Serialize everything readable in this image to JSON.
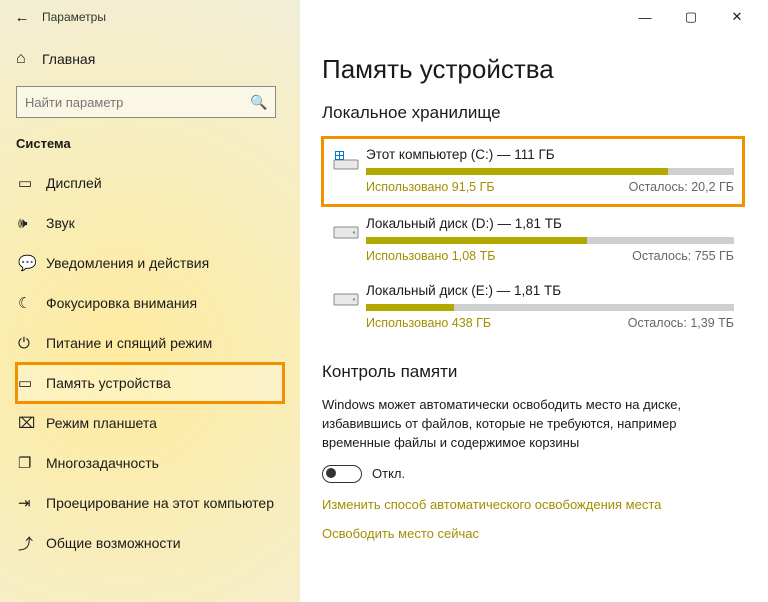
{
  "titlebar": {
    "title": "Параметры"
  },
  "sidebar": {
    "home": "Главная",
    "search_placeholder": "Найти параметр",
    "category": "Система",
    "items": [
      {
        "icon": "display",
        "label": "Дисплей"
      },
      {
        "icon": "sound",
        "label": "Звук"
      },
      {
        "icon": "notify",
        "label": "Уведомления и действия"
      },
      {
        "icon": "focus",
        "label": "Фокусировка внимания"
      },
      {
        "icon": "power",
        "label": "Питание и спящий режим"
      },
      {
        "icon": "storage",
        "label": "Память устройства",
        "selected": true
      },
      {
        "icon": "tablet",
        "label": "Режим планшета"
      },
      {
        "icon": "multi",
        "label": "Многозадачность"
      },
      {
        "icon": "project",
        "label": "Проецирование на этот компьютер"
      },
      {
        "icon": "shared",
        "label": "Общие возможности"
      }
    ]
  },
  "content": {
    "page_title": "Память устройства",
    "local_storage_title": "Локальное хранилище",
    "disks": [
      {
        "name": "Этот компьютер (C:) — 111 ГБ",
        "used": "Использовано 91,5 ГБ",
        "free": "Осталось: 20,2 ГБ",
        "pct": 82,
        "system": true,
        "highlight": true
      },
      {
        "name": "Локальный диск (D:) — 1,81 ТБ",
        "used": "Использовано 1,08 ТБ",
        "free": "Осталось: 755 ГБ",
        "pct": 60
      },
      {
        "name": "Локальный диск (E:) — 1,81 ТБ",
        "used": "Использовано 438 ГБ",
        "free": "Осталось: 1,39 ТБ",
        "pct": 24
      }
    ],
    "sense_title": "Контроль памяти",
    "sense_desc": "Windows может автоматически освободить место на диске, избавившись от файлов, которые не требуются, например временные файлы и содержимое корзины",
    "toggle_label": "Откл.",
    "link_change": "Изменить способ автоматического освобождения места",
    "link_free_now": "Освободить место сейчас"
  }
}
